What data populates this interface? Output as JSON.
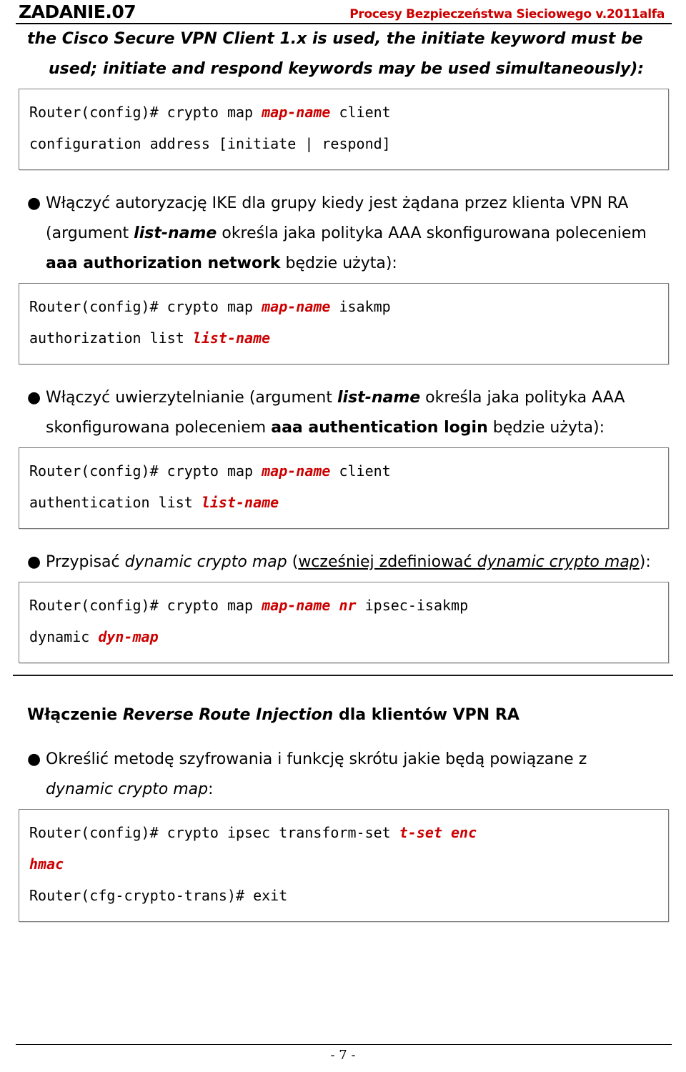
{
  "header": {
    "task_label": "ZADANIE.07",
    "course_title": "Procesy Bezpieczeństwa Sieciowego  v.2011alfa",
    "accent_color": "#cc0000"
  },
  "intro": {
    "line1": "the Cisco Secure VPN Client 1.x is used, the initiate keyword must be",
    "line2": "used; initiate and respond keywords may be used simultaneously):"
  },
  "code_blocks": {
    "block1": {
      "line1_pre": "Router(config)# crypto map ",
      "line1_var": "map-name",
      "line1_post": " client",
      "line2": "configuration address [initiate | respond]"
    },
    "block2": {
      "line1_pre": "Router(config)# crypto map ",
      "line1_var": "map-name",
      "line1_post": " isakmp",
      "line2_pre": "authorization list ",
      "line2_var": "list-name"
    },
    "block3": {
      "line1_pre": "Router(config)# crypto map ",
      "line1_var": "map-name",
      "line1_post": " client",
      "line2_pre": "authentication list ",
      "line2_var": "list-name"
    },
    "block4": {
      "line1_pre": "Router(config)# crypto map ",
      "line1_var1": "map-name",
      "line1_mid": " ",
      "line1_var2": "nr",
      "line1_post": " ipsec-isakmp",
      "line2_pre": "dynamic ",
      "line2_var": "dyn-map"
    },
    "block5": {
      "line1_pre": "Router(config)# crypto ipsec transform-set ",
      "line1_var": "t-set enc",
      "line2_var": "hmac",
      "line3": "Router(cfg-crypto-trans)# exit"
    }
  },
  "bullets": {
    "bullet_glyph": "●",
    "b1": {
      "seg1": "Włączyć autoryzację IKE dla grupy kiedy jest żądana przez klienta VPN RA (argument ",
      "seg2_bolditalic": "list-name",
      "seg3": " określa jaka polityka AAA skonfigurowana poleceniem ",
      "seg4_bold": "aaa authorization network",
      "seg5": " będzie użyta):"
    },
    "b2": {
      "seg1": "Włączyć uwierzytelnianie (argument ",
      "seg2_bolditalic": "list-name",
      "seg3": " określa jaka polityka AAA skonfigurowana poleceniem ",
      "seg4_bold": "aaa authentication login",
      "seg5": " będzie użyta):"
    },
    "b3": {
      "seg1": "Przypisać ",
      "seg2_italic": "dynamic crypto map",
      "seg3": " (",
      "seg4_underline": "wcześniej zdefiniować ",
      "seg5_underline_italic": "dynamic crypto map",
      "seg6": "):"
    },
    "b4": {
      "seg1": "Określić metodę szyfrowania i funkcję skrótu jakie będą powiązane z ",
      "seg2_italic": "dynamic crypto map",
      "seg3": ":"
    }
  },
  "section": {
    "heading_pre": "Włączenie ",
    "heading_italic": "Reverse Route Injection",
    "heading_post": " dla klientów VPN RA"
  },
  "footer": {
    "page_number": "- 7 -"
  }
}
